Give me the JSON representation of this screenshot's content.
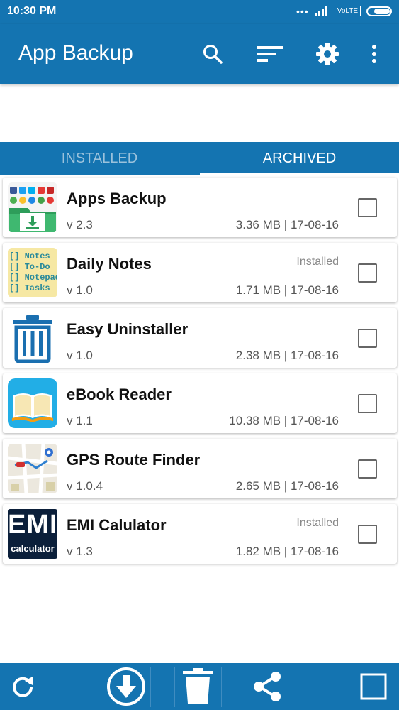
{
  "status_bar": {
    "time": "10:30 PM",
    "network": "VoLTE"
  },
  "app_bar": {
    "title": "App Backup"
  },
  "tabs": [
    {
      "label": "INSTALLED"
    },
    {
      "label": "ARCHIVED"
    }
  ],
  "apps": [
    {
      "name": "Apps Backup",
      "version": "v 2.3",
      "meta": "3.36 MB | 17-08-16",
      "status": ""
    },
    {
      "name": "Daily Notes",
      "version": "v 1.0",
      "meta": "1.71 MB | 17-08-16",
      "status": "Installed",
      "icon_lines": [
        "[] Notes",
        "[] To-Do",
        "[] Notepad",
        "[] Tasks"
      ]
    },
    {
      "name": "Easy Uninstaller",
      "version": "v 1.0",
      "meta": "2.38 MB | 17-08-16",
      "status": ""
    },
    {
      "name": "eBook Reader",
      "version": "v 1.1",
      "meta": "10.38 MB | 17-08-16",
      "status": ""
    },
    {
      "name": "GPS Route Finder",
      "version": "v 1.0.4",
      "meta": "2.65 MB | 17-08-16",
      "status": ""
    },
    {
      "name": "EMI Calulator",
      "version": "v 1.3",
      "meta": "1.82 MB | 17-08-16",
      "status": "Installed",
      "icon_text_top": "EMI",
      "icon_text_bottom": "calculator"
    }
  ],
  "colors": {
    "primary": "#1474b1",
    "tab_inactive": "#9bc2dc"
  },
  "icons": [
    "search-icon",
    "sort-icon",
    "gear-icon",
    "more-vert-icon",
    "refresh-icon",
    "download-icon",
    "trash-icon",
    "share-icon",
    "select-all-icon"
  ]
}
